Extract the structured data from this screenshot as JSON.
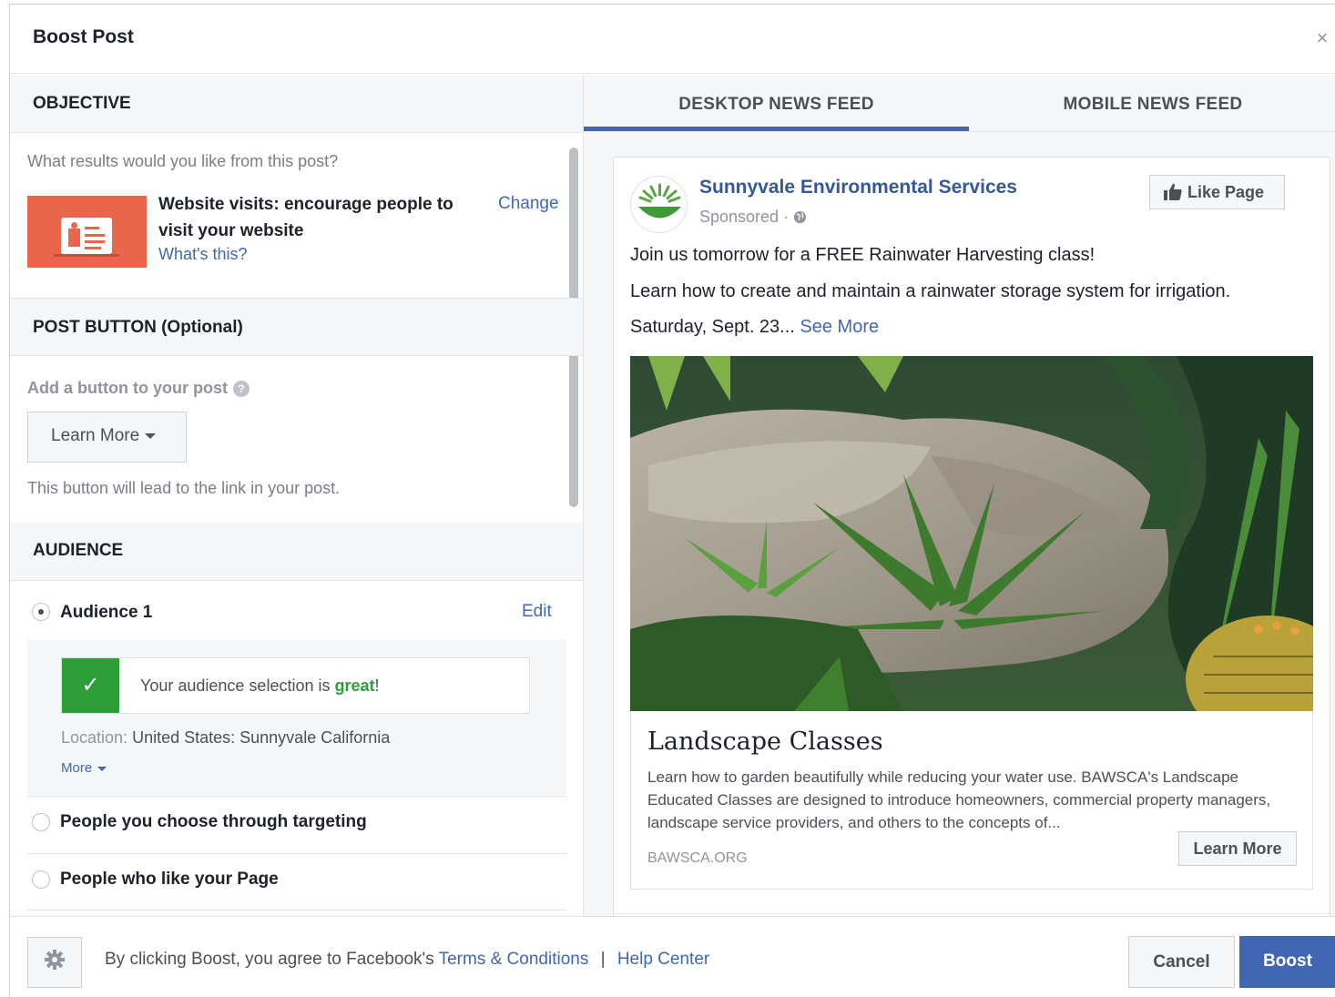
{
  "header": {
    "title": "Boost Post",
    "close_label": "×"
  },
  "objective": {
    "section_title": "OBJECTIVE",
    "question": "What results would you like from this post?",
    "title": "Website visits: encourage people to visit your website",
    "whats_this": "What's this?",
    "change": "Change"
  },
  "post_button": {
    "section_title": "POST BUTTON (Optional)",
    "prompt": "Add a button to your post",
    "info_glyph": "?",
    "selected": "Learn More",
    "helper": "This button will lead to the link in your post."
  },
  "audience": {
    "section_title": "AUDIENCE",
    "selected_name": "Audience 1",
    "edit": "Edit",
    "great_prefix": "Your audience selection is ",
    "great_word": "great",
    "great_suffix": "!",
    "location_label": "Location:",
    "location_value": "United States: Sunnyvale California",
    "more": "More",
    "options": [
      "People you choose through targeting",
      "People who like your Page"
    ]
  },
  "preview": {
    "tabs": [
      "DESKTOP NEWS FEED",
      "MOBILE NEWS FEED"
    ],
    "active_tab": "DESKTOP NEWS FEED",
    "page_name": "Sunnyvale Environmental Services",
    "sponsored": "Sponsored · ",
    "like_page": "Like Page",
    "text_line1": "Join us tomorrow for a FREE Rainwater Harvesting class!",
    "text_line2": "Learn how to create and maintain a rainwater storage system for irrigation.",
    "text_line3": "Saturday, Sept. 23... ",
    "see_more": "See More",
    "link_title": "Landscape Classes",
    "link_description": "Learn how to garden beautifully while reducing your water use. BAWSCA's Landscape Educated Classes are designed to introduce homeowners, commercial property managers, landscape service providers, and others to the concepts of...",
    "link_domain": "BAWSCA.ORG",
    "link_button": "Learn More"
  },
  "footer": {
    "agree_text": "By clicking Boost, you agree to Facebook's ",
    "terms": "Terms & Conditions",
    "separator": "|",
    "help": "Help Center",
    "cancel": "Cancel",
    "boost": "Boost"
  },
  "colors": {
    "accent": "#4267b2",
    "link": "#365899",
    "success": "#2e9e3a",
    "objective_thumb": "#e9664c"
  },
  "icons": [
    "close-icon",
    "objective-thumbnail-icon",
    "info-icon",
    "caret-down-icon",
    "check-icon",
    "globe-icon",
    "thumbs-up-icon",
    "gear-icon",
    "page-logo-icon"
  ]
}
